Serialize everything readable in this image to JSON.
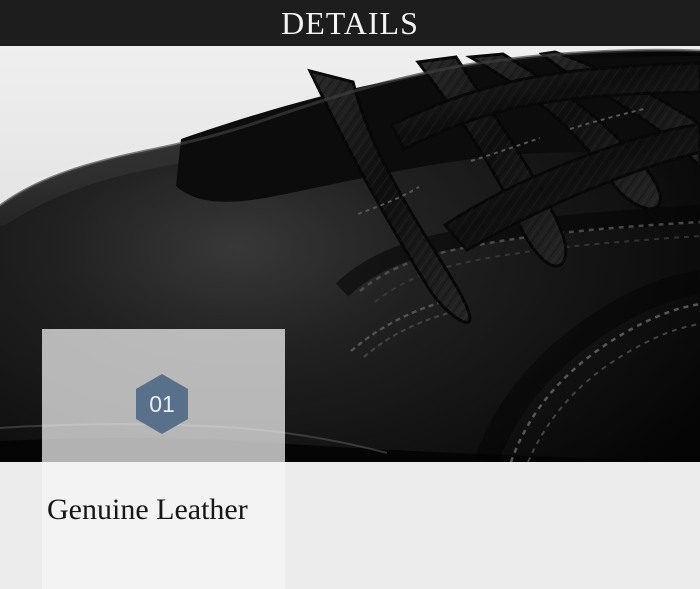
{
  "header": {
    "title": "DETAILS"
  },
  "feature": {
    "number": "01",
    "title": "Genuine Leather"
  },
  "colors": {
    "header_background": "#1d1d1d",
    "badge": "#58708a",
    "shoe": "#171717"
  },
  "image": {
    "subject": "black-leather-shoe"
  }
}
